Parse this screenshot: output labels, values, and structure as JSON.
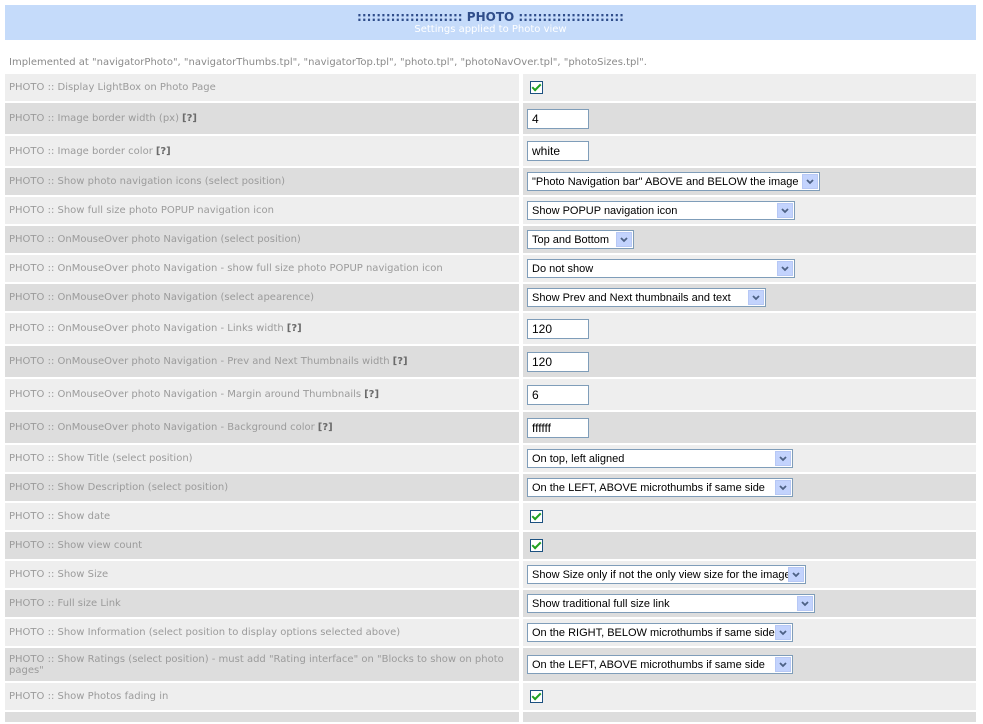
{
  "header": {
    "title": ":::::::::::::::::::::: PHOTO ::::::::::::::::::::::",
    "subtitle": "Settings applied to Photo view"
  },
  "implemented": "Implemented at \"navigatorPhoto\", \"navigatorThumbs.tpl\", \"navigatorTop.tpl\", \"photo.tpl\", \"photoNavOver.tpl\", \"photoSizes.tpl\".",
  "rows": [
    {
      "label": "PHOTO :: Display LightBox on Photo Page",
      "help": "",
      "control": {
        "type": "checkbox",
        "checked": true
      }
    },
    {
      "label": "PHOTO :: Image border width (px)",
      "help": "[?]",
      "control": {
        "type": "text",
        "value": "4"
      }
    },
    {
      "label": "PHOTO :: Image border color",
      "help": "[?]",
      "control": {
        "type": "text",
        "value": "white"
      }
    },
    {
      "label": "PHOTO :: Show photo navigation icons (select position)",
      "help": "",
      "control": {
        "type": "select",
        "value": "\"Photo Navigation bar\" ABOVE and BELOW the image"
      }
    },
    {
      "label": "PHOTO :: Show full size photo POPUP navigation icon",
      "help": "",
      "control": {
        "type": "select",
        "value": "Show POPUP navigation icon"
      }
    },
    {
      "label": "PHOTO :: OnMouseOver photo Navigation (select position)",
      "help": "",
      "control": {
        "type": "select",
        "value": "Top and Bottom"
      }
    },
    {
      "label": "PHOTO :: OnMouseOver photo Navigation - show full size photo POPUP navigation icon",
      "help": "",
      "control": {
        "type": "select",
        "value": "Do not show"
      }
    },
    {
      "label": "PHOTO :: OnMouseOver photo Navigation (select apearence)",
      "help": "",
      "control": {
        "type": "select",
        "value": "Show Prev and Next thumbnails and text"
      }
    },
    {
      "label": "PHOTO :: OnMouseOver photo Navigation - Links width",
      "help": "[?]",
      "control": {
        "type": "text",
        "value": "120"
      }
    },
    {
      "label": "PHOTO :: OnMouseOver photo Navigation - Prev and Next Thumbnails width",
      "help": "[?]",
      "control": {
        "type": "text",
        "value": "120"
      }
    },
    {
      "label": "PHOTO :: OnMouseOver photo Navigation - Margin around Thumbnails",
      "help": "[?]",
      "control": {
        "type": "text",
        "value": "6"
      }
    },
    {
      "label": "PHOTO :: OnMouseOver photo Navigation - Background color",
      "help": "[?]",
      "control": {
        "type": "text",
        "value": "ffffff"
      }
    },
    {
      "label": "PHOTO :: Show Title (select position)",
      "help": "",
      "control": {
        "type": "select",
        "value": "On top, left aligned"
      }
    },
    {
      "label": "PHOTO :: Show Description (select position)",
      "help": "",
      "control": {
        "type": "select",
        "value": "On the LEFT, ABOVE microthumbs if same side"
      }
    },
    {
      "label": "PHOTO :: Show date",
      "help": "",
      "control": {
        "type": "checkbox",
        "checked": true
      }
    },
    {
      "label": "PHOTO :: Show view count",
      "help": "",
      "control": {
        "type": "checkbox",
        "checked": true
      }
    },
    {
      "label": "PHOTO :: Show Size",
      "help": "",
      "control": {
        "type": "select",
        "value": "Show Size only if not the only view size for the image"
      }
    },
    {
      "label": "PHOTO :: Full size Link",
      "help": "",
      "control": {
        "type": "select",
        "value": "Show traditional full size link"
      }
    },
    {
      "label": "PHOTO :: Show Information (select position to display options selected above)",
      "help": "",
      "control": {
        "type": "select",
        "value": "On the RIGHT, BELOW microthumbs if same side"
      }
    },
    {
      "label": "PHOTO :: Show Ratings (select position) - must add \"Rating interface\" on \"Blocks to show on photo pages\"",
      "help": "",
      "control": {
        "type": "select",
        "value": "On the LEFT, ABOVE microthumbs if same side"
      }
    },
    {
      "label": "PHOTO :: Show Photos fading in",
      "help": "",
      "control": {
        "type": "checkbox",
        "checked": true
      }
    },
    {
      "label": "",
      "help": "",
      "control": {
        "type": "none"
      }
    }
  ],
  "colors": {
    "header_bg": "#c5dbfa",
    "header_title": "#2f4d8a",
    "row_light": "#eeeeee",
    "row_dark": "#dddddd",
    "label_text": "#9b9b9b",
    "check_mark": "#21a121"
  }
}
